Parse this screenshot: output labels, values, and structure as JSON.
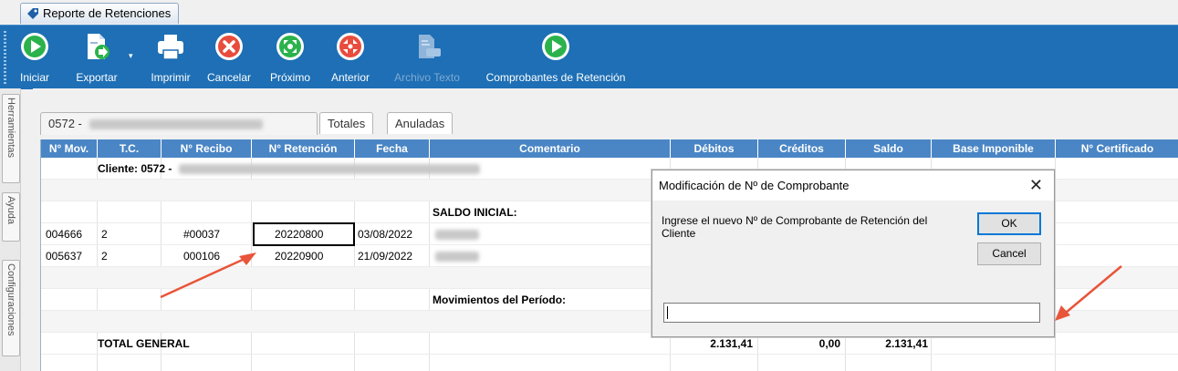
{
  "document_tab": {
    "title": "Reporte de Retenciones"
  },
  "toolbar": {
    "buttons": [
      {
        "label": "Iniciar",
        "icon": "play-circle-icon",
        "enabled": true
      },
      {
        "label": "Exportar",
        "icon": "export-document-icon",
        "enabled": true
      },
      {
        "label": "Imprimir",
        "icon": "printer-icon",
        "enabled": true
      },
      {
        "label": "Cancelar",
        "icon": "cancel-x-circle-icon",
        "enabled": true
      },
      {
        "label": "Próximo",
        "icon": "next-expand-icon",
        "enabled": true
      },
      {
        "label": "Anterior",
        "icon": "previous-collapse-icon",
        "enabled": true
      },
      {
        "label": "Archivo Texto",
        "icon": "text-file-icon",
        "enabled": false
      },
      {
        "label": "Comprobantes de Retención",
        "icon": "play-circle-icon",
        "enabled": true
      }
    ]
  },
  "side_tabs": [
    "Herramientas",
    "Ayuda",
    "Configuraciones"
  ],
  "report_tabs": {
    "active": "0572 -",
    "others": [
      "Totales",
      "Anuladas"
    ]
  },
  "grid": {
    "columns": [
      "N° Mov.",
      "T.C.",
      "N° Recibo",
      "N° Retención",
      "Fecha",
      "Comentario",
      "Débitos",
      "Créditos",
      "Saldo",
      "Base Imponible",
      "N° Certificado"
    ],
    "client_label": "Cliente: 0572 -",
    "saldo_inicial": "SALDO INICIAL:",
    "rows": [
      {
        "mov": "004666",
        "tc": "2",
        "recibo": "#00037",
        "retencion": "20220800",
        "fecha": "03/08/2022"
      },
      {
        "mov": "005637",
        "tc": "2",
        "recibo": "000106",
        "retencion": "20220900",
        "fecha": "21/09/2022"
      }
    ],
    "movimientos": "Movimientos del Período:",
    "total": {
      "label": "TOTAL GENERAL",
      "debitos": "2.131,41",
      "creditos": "0,00",
      "saldo": "2.131,41"
    }
  },
  "dialog": {
    "title": "Modificación de Nº de Comprobante",
    "close": "✕",
    "message": "Ingrese el nuevo Nº de Comprobante de Retención del Cliente",
    "ok_label": "OK",
    "cancel_label": "Cancel",
    "input_value": ""
  },
  "colors": {
    "ribbon": "#1e6fb5",
    "grid_header": "#4a86c5",
    "annotation_arrow": "#e8553a",
    "icon_green": "#2bb24c",
    "icon_red": "#e84c3d"
  }
}
